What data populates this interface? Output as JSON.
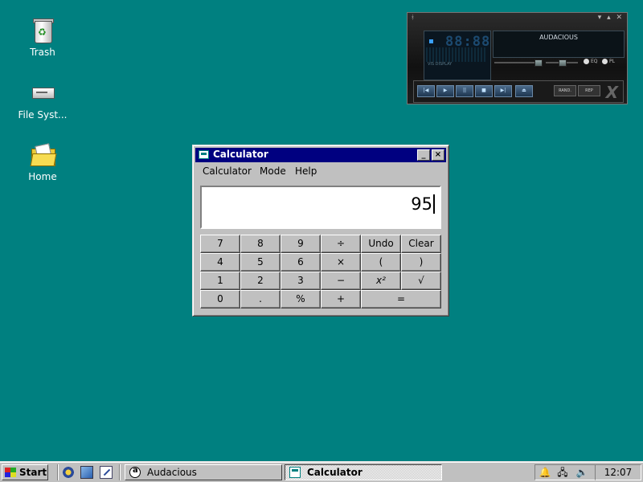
{
  "desktop": {
    "icons": [
      {
        "label": "Trash",
        "icon": "trash-icon"
      },
      {
        "label": "File Syst...",
        "icon": "drive-icon"
      },
      {
        "label": "Home",
        "icon": "folder-icon"
      }
    ]
  },
  "audacious": {
    "title": "AUDACIOUS",
    "time": "88:88",
    "vis_label": "VIS DISPLAY",
    "eq_label": "EQ",
    "pl_label": "PL",
    "shuffle_label": "RAND.",
    "repeat_label": "REP",
    "buttons": [
      "prev",
      "play",
      "pause",
      "stop",
      "next",
      "eject"
    ]
  },
  "calculator": {
    "title": "Calculator",
    "menu": [
      "Calculator",
      "Mode",
      "Help"
    ],
    "display": "95",
    "keys": [
      [
        "7",
        "8",
        "9",
        "÷",
        "Undo",
        "Clear"
      ],
      [
        "4",
        "5",
        "6",
        "×",
        "(",
        ")"
      ],
      [
        "1",
        "2",
        "3",
        "−",
        "x²",
        "√"
      ],
      [
        "0",
        ".",
        "%",
        "+",
        "="
      ]
    ],
    "minimize_label": "_",
    "close_label": "×"
  },
  "taskbar": {
    "start_label": "Start",
    "tasks": [
      {
        "label": "Audacious",
        "active": false
      },
      {
        "label": "Calculator",
        "active": true
      }
    ],
    "clock": "12:07 AM"
  }
}
